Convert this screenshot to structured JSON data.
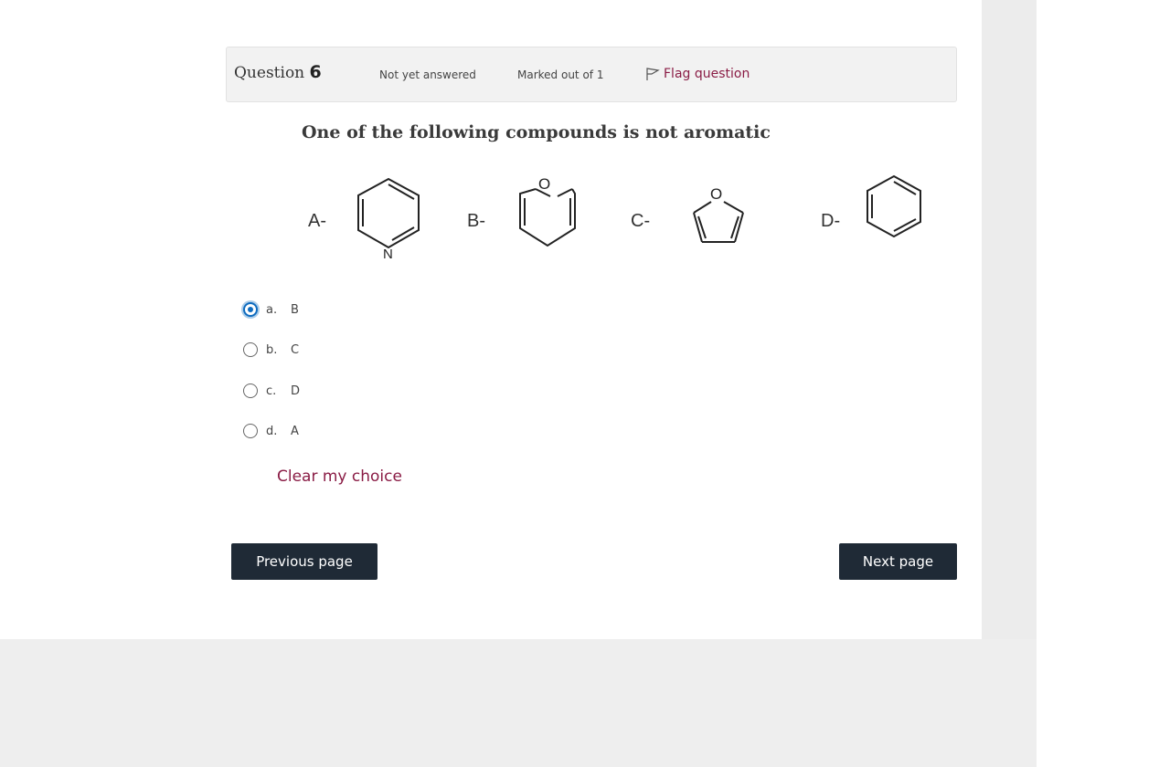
{
  "question": {
    "label": "Question",
    "number": "6",
    "state": "Not yet answered",
    "grade": "Marked out of 1",
    "flag_label": "Flag question",
    "text": "One of the following compounds is not aromatic"
  },
  "structures": [
    {
      "label": "A-",
      "molecule": "pyridine",
      "heteroatom": "N"
    },
    {
      "label": "B-",
      "molecule": "4H-pyran",
      "heteroatom": "O"
    },
    {
      "label": "C-",
      "molecule": "furan",
      "heteroatom": "O"
    },
    {
      "label": "D-",
      "molecule": "benzene",
      "heteroatom": ""
    }
  ],
  "answers": [
    {
      "num": "a.",
      "text": "B",
      "checked": true
    },
    {
      "num": "b.",
      "text": "C",
      "checked": false
    },
    {
      "num": "c.",
      "text": "D",
      "checked": false
    },
    {
      "num": "d.",
      "text": "A",
      "checked": false
    }
  ],
  "clear_label": "Clear my choice",
  "nav": {
    "prev_label": "Previous page",
    "next_label": "Next page"
  },
  "colors": {
    "accent": "#8a1c45",
    "button": "#1f2a36",
    "radio_checked": "#0f6cbf"
  }
}
